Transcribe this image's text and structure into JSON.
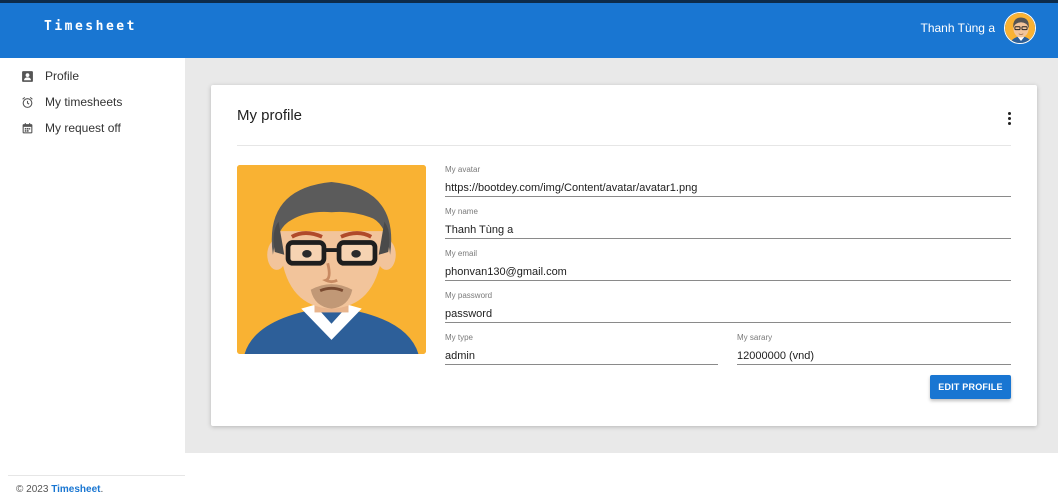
{
  "header": {
    "brand": "Timesheet",
    "user_name": "Thanh Tùng a",
    "avatar_icon": "avatar-icon",
    "bar_color": "#1976d2"
  },
  "sidebar": {
    "items": [
      {
        "label": "Profile",
        "icon": "profile-icon"
      },
      {
        "label": "My timesheets",
        "icon": "alarm-clock-icon"
      },
      {
        "label": "My request off",
        "icon": "calendar-icon"
      }
    ]
  },
  "profile": {
    "title": "My profile",
    "avatar_image": "avatar-image",
    "fields": {
      "avatar": {
        "label": "My avatar",
        "value": "https://bootdey.com/img/Content/avatar/avatar1.png"
      },
      "name": {
        "label": "My name",
        "value": "Thanh Tùng a"
      },
      "email": {
        "label": "My email",
        "value": "phonvan130@gmail.com"
      },
      "password": {
        "label": "My password",
        "value": "password"
      },
      "type": {
        "label": "My type",
        "value": "admin"
      },
      "salary": {
        "label": "My sarary",
        "value": "12000000 (vnd)"
      }
    },
    "edit_button": "EDIT PROFILE"
  },
  "footer": {
    "copyright": "© 2023",
    "link": "Timesheet",
    "period": "."
  }
}
